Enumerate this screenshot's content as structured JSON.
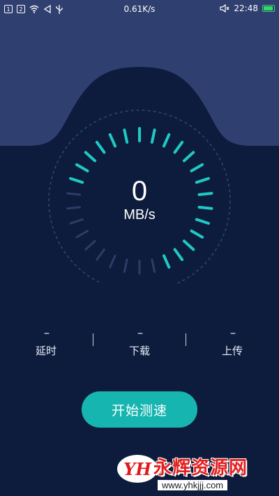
{
  "status_bar": {
    "sim1": "1",
    "sim2": "2",
    "net_speed": "0.61K/s",
    "time": "22:48",
    "battery_level": 0.9,
    "icons": [
      "sim1-icon",
      "sim2-icon",
      "wifi-icon",
      "nav-back-icon",
      "usb-icon",
      "mute-icon",
      "battery-icon"
    ]
  },
  "speedometer": {
    "value": "0",
    "unit": "MB/s",
    "active_ticks": 20,
    "total_ticks": 30,
    "colors": {
      "active": "#1fc9c4",
      "inactive": "#2a3e67",
      "bg": "#0d1c3c",
      "hill": "#2f3f6f"
    }
  },
  "stats": [
    {
      "value": "--",
      "label": "延时"
    },
    {
      "value": "--",
      "label": "下载"
    },
    {
      "value": "--",
      "label": "上传"
    }
  ],
  "actions": {
    "start_label": "开始测速"
  },
  "watermark": {
    "logo": "YH",
    "title": "永辉资源网",
    "url": "www.yhkjjj.com"
  }
}
